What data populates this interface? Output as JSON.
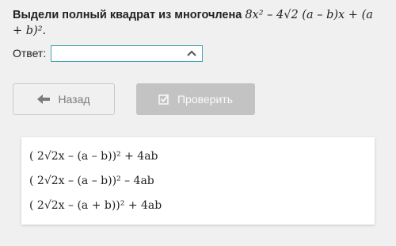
{
  "question": {
    "prefix": "Выдели полный квадрат из многочлена",
    "expression": "8x² – 4√2 (a – b)x + (a + b)²."
  },
  "answer": {
    "label": "Ответ:",
    "selected": ""
  },
  "buttons": {
    "back_label": "Назад",
    "check_label": "Проверить"
  },
  "options": [
    "( 2√2x – (a – b))² + 4ab",
    "( 2√2x – (a – b))² – 4ab",
    "( 2√2x – (a + b))² + 4ab"
  ],
  "colors": {
    "accent": "#48a6b3",
    "check_button_bg": "#c3c3c3",
    "page_bg": "#f0f0f0"
  },
  "icons": {
    "dropdown": "chevron-up-icon",
    "back": "arrow-left-icon",
    "check": "checkbox-check-icon"
  }
}
